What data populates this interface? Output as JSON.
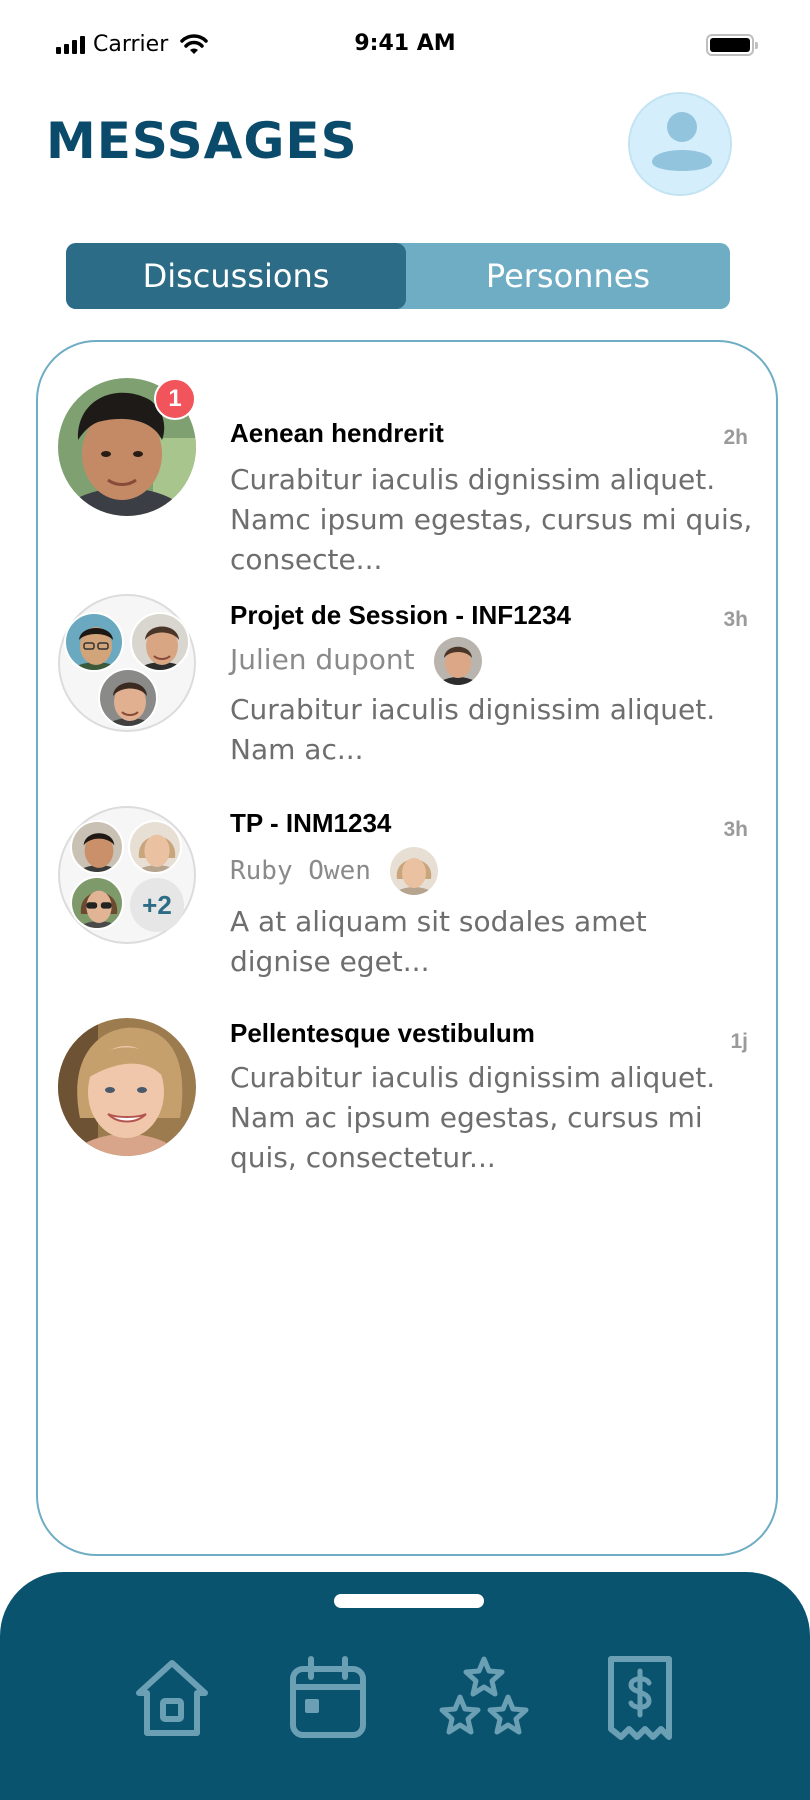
{
  "status_bar": {
    "carrier": "Carrier",
    "time": "9:41 AM"
  },
  "header": {
    "title": "MESSAGES"
  },
  "tabs": [
    {
      "label": "Discussions",
      "active": true
    },
    {
      "label": "Personnes",
      "active": false
    }
  ],
  "conversations": [
    {
      "title": "Aenean hendrerit",
      "time": "2h",
      "unread": "1",
      "preview_lines": [
        "Curabitur iaculis dignissim aliquet.",
        "Namc ipsum egestas, cursus mi quis,",
        "consecte..."
      ]
    },
    {
      "title": "Projet de Session - INF1234",
      "time": "3h",
      "sender": "Julien dupont",
      "preview_lines": [
        "Curabitur iaculis dignissim aliquet.",
        "Nam ac..."
      ]
    },
    {
      "title": "TP - INM1234",
      "time": "3h",
      "sender": "Ruby Owen",
      "extra_members": "+2",
      "preview_lines": [
        "A at aliquam sit sodales amet",
        "dignise eget..."
      ]
    },
    {
      "title": "Pellentesque vestibulum",
      "time": "1j",
      "preview_lines": [
        "Curabitur iaculis dignissim aliquet.",
        "Nam ac ipsum egestas, cursus mi",
        "quis, consectetur..."
      ]
    }
  ],
  "bottom_nav": {
    "items": [
      {
        "icon": "home-icon"
      },
      {
        "icon": "calendar-icon"
      },
      {
        "icon": "stars-icon"
      },
      {
        "icon": "receipt-dollar-icon"
      }
    ]
  },
  "colors": {
    "primary": "#0a536e",
    "title": "#0a4b6b",
    "tab_active": "#2d6c86",
    "tab_inactive": "#6fadc5",
    "card_border": "#6eadc4",
    "badge": "#f2545b",
    "nav_icon": "#6b9fb4"
  }
}
